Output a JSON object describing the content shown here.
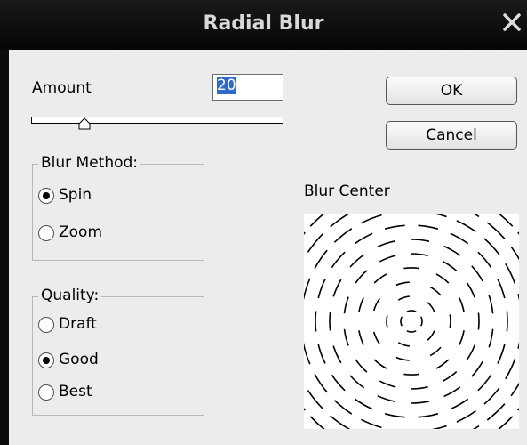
{
  "dialog": {
    "title": "Radial Blur",
    "close_icon": "close-x-icon"
  },
  "amount": {
    "label": "Amount",
    "value": "20",
    "slider_fraction": 0.2
  },
  "buttons": {
    "ok": "OK",
    "cancel": "Cancel"
  },
  "blur_method": {
    "legend": "Blur Method:",
    "options": [
      "Spin",
      "Zoom"
    ],
    "selected": "Spin"
  },
  "quality": {
    "legend": "Quality:",
    "options": [
      "Draft",
      "Good",
      "Best"
    ],
    "selected": "Good"
  },
  "blur_center": {
    "label": "Blur Center"
  }
}
